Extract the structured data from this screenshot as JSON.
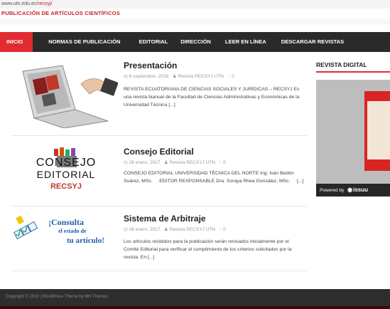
{
  "browser": {
    "url_host": "www.utn.edu.ec",
    "url_path": "/recsyj/"
  },
  "site": {
    "subtitle": "PUBLICACIÓN DE ARTÍCULOS CIENTÍFICOS"
  },
  "nav": {
    "items": [
      {
        "label": "INICIO"
      },
      {
        "label": "NORMAS DE PUBLICACIÓN"
      },
      {
        "label": "EDITORIAL"
      },
      {
        "label": "DIRECCIÓN"
      },
      {
        "label": "LEER EN LÍNEA"
      },
      {
        "label": "DESCARGAR REVISTAS"
      }
    ]
  },
  "posts": [
    {
      "title": "Presentación",
      "date": "6 septiembre, 2016",
      "author": "Revista RECSYJ UTN",
      "comments": "0",
      "excerpt": "REVISTA ECUATORIANA DE CIENCIAS SOCIALES Y JURÍDICAS – RECSYJ Es una revista bianual de la Facultad de Ciencias Administrativas y Económicas de la Universidad Técnica [...]"
    },
    {
      "title": "Consejo Editorial",
      "date": "26 enero, 2017",
      "author": "Revista RECSYJ UTN",
      "comments": "0",
      "excerpt": "CONSEJO EDITORIAL UNIVERSIDAD TÉCNICA DEL NORTE Ing. Iván Bedón Suárez, MSc.     EDITOR RESPONSABLE Dra. Soraya Rhea González, MSc.     [...]",
      "thumb_lines": [
        "CONSEJO",
        "EDITORIAL",
        "RECSYJ"
      ]
    },
    {
      "title": "Sistema de Arbitraje",
      "date": "26 enero, 2017",
      "author": "Revista RECSYJ UTN",
      "comments": "0",
      "excerpt": "Los artículos recibidos para la publicación serán revisados inicialmente por el Comité Editorial para verificar el cumplimiento de los criterios solicitados por la revista. En [...]",
      "thumb_lines": [
        "¡Consulta",
        "el estado de",
        "tu artículo!"
      ]
    }
  ],
  "sidebar": {
    "title": "REVISTA DIGITAL",
    "powered_label": "Powered by",
    "issuu_brand": "issuu"
  },
  "footer": {
    "text": "Copyright © 2019 | WordPress Theme by MH Themes"
  },
  "colors": {
    "accent": "#e12b31",
    "nav_bg": "#2a2a2a",
    "footer_bg": "#2e2e2e"
  },
  "icons": {
    "date": "clock-icon",
    "author": "user-icon",
    "comments": "comment-icon"
  }
}
